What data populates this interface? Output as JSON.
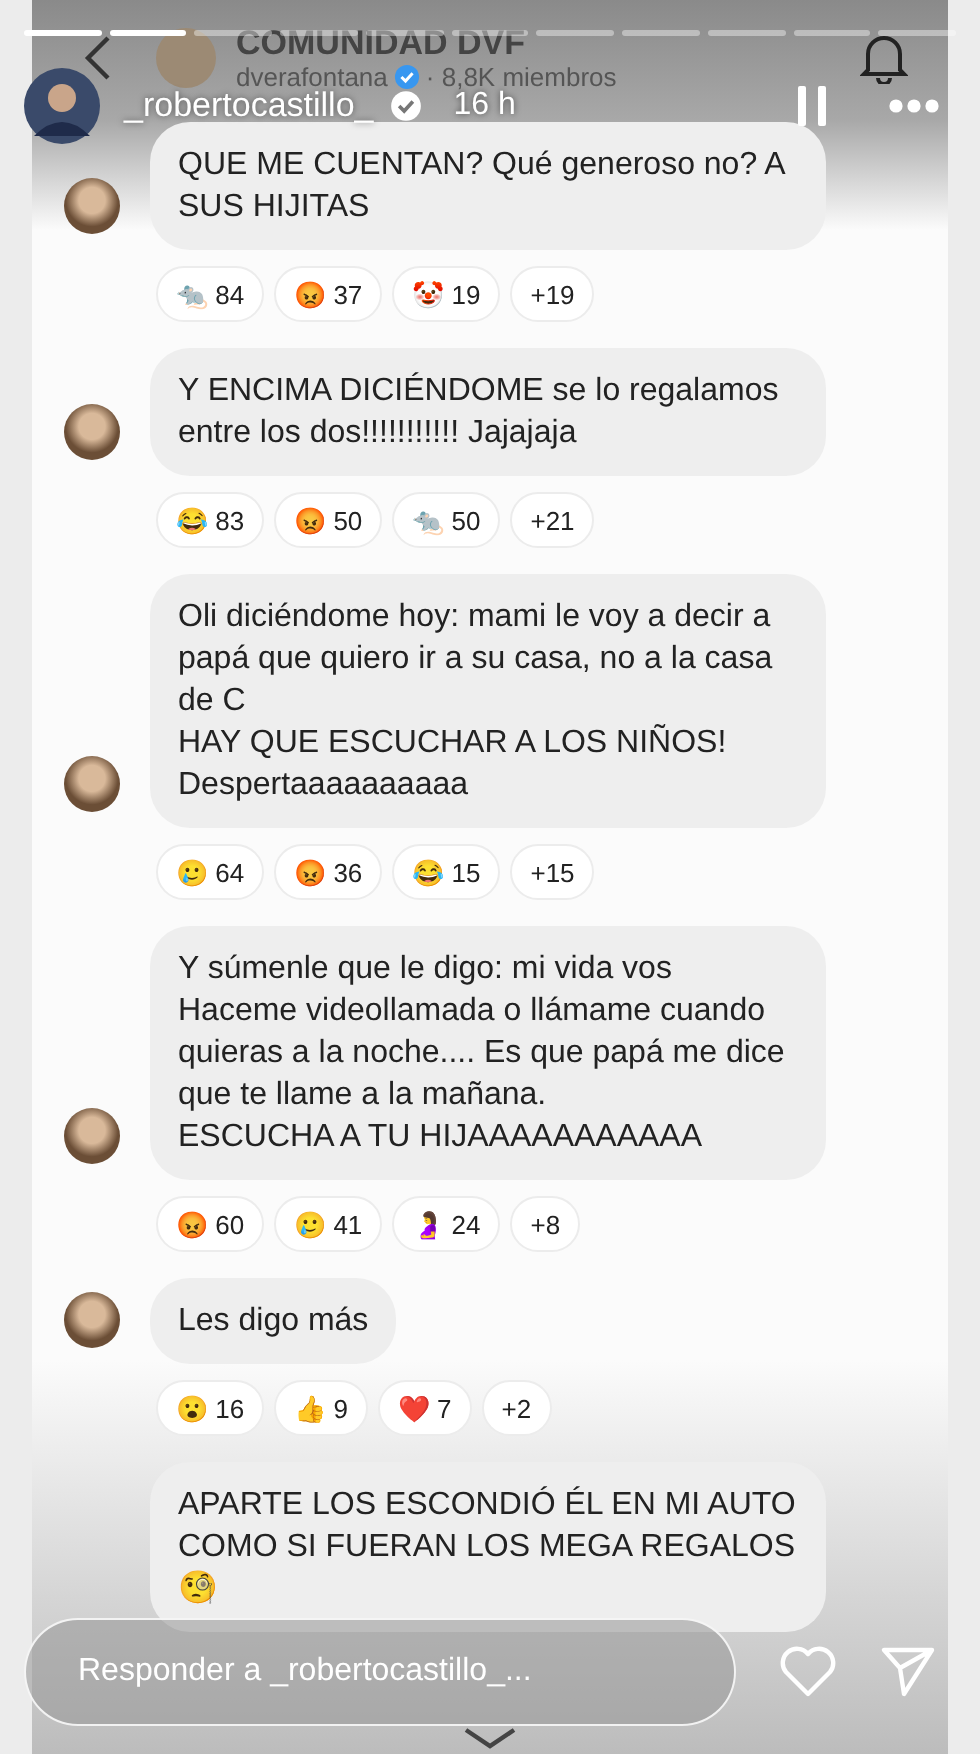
{
  "story": {
    "segments": [
      {
        "viewed": true
      },
      {
        "viewed": true
      },
      {
        "viewed": false
      },
      {
        "viewed": false
      },
      {
        "viewed": false
      },
      {
        "viewed": false
      },
      {
        "viewed": false
      },
      {
        "viewed": false
      },
      {
        "viewed": false
      },
      {
        "viewed": false
      },
      {
        "viewed": false
      }
    ],
    "username": "_robertocastillo_",
    "verified": true,
    "time": "16 h"
  },
  "channel": {
    "title": "COMUNIDAD DVF",
    "owner": "dverafontana",
    "verified": true,
    "members": "· 8,8K miembros"
  },
  "messages": [
    {
      "text": "QUE ME CUENTAN? Qué generoso no? A SUS HIJITAS",
      "show_avatar": true,
      "reactions": [
        {
          "emoji": "🐀",
          "count": "84"
        },
        {
          "emoji": "😡",
          "count": "37"
        },
        {
          "emoji": "🤡",
          "count": "19"
        }
      ],
      "extra": "+19"
    },
    {
      "text": "Y ENCIMA DICIÉNDOME se lo regalamos entre los dos!!!!!!!!!!! Jajajaja",
      "show_avatar": true,
      "reactions": [
        {
          "emoji": "😂",
          "count": "83"
        },
        {
          "emoji": "😡",
          "count": "50"
        },
        {
          "emoji": "🐀",
          "count": "50"
        }
      ],
      "extra": "+21"
    },
    {
      "text": "Oli diciéndome hoy: mami le voy a decir a papá que quiero ir a su casa, no a la casa de C\nHAY QUE ESCUCHAR A LOS NIÑOS!\nDespertaaaaaaaaaa",
      "show_avatar": true,
      "reactions": [
        {
          "emoji": "🥲",
          "count": "64"
        },
        {
          "emoji": "😡",
          "count": "36"
        },
        {
          "emoji": "😂",
          "count": "15"
        }
      ],
      "extra": "+15"
    },
    {
      "text": "Y súmenle que le digo: mi vida vos\nHaceme videollamada o llámame cuando quieras a la noche.... Es que papá me dice que te llame a la mañana.\nESCUCHA A TU HIJAAAAAAAAAAA",
      "show_avatar": true,
      "reactions": [
        {
          "emoji": "😡",
          "count": "60"
        },
        {
          "emoji": "🥲",
          "count": "41"
        },
        {
          "emoji": "🤰",
          "count": "24"
        }
      ],
      "extra": "+8"
    },
    {
      "text": "Les digo más",
      "show_avatar": true,
      "reactions": [
        {
          "emoji": "😮",
          "count": "16"
        },
        {
          "emoji": "👍",
          "count": "9"
        },
        {
          "emoji": "❤️",
          "count": "7"
        }
      ],
      "extra": "+2"
    },
    {
      "text": "APARTE LOS ESCONDIÓ ÉL EN MI AUTO COMO SI FUERAN LOS MEGA REGALOS\n🧐",
      "show_avatar": false
    }
  ],
  "reply": {
    "placeholder": "Responder a _robertocastillo_..."
  }
}
